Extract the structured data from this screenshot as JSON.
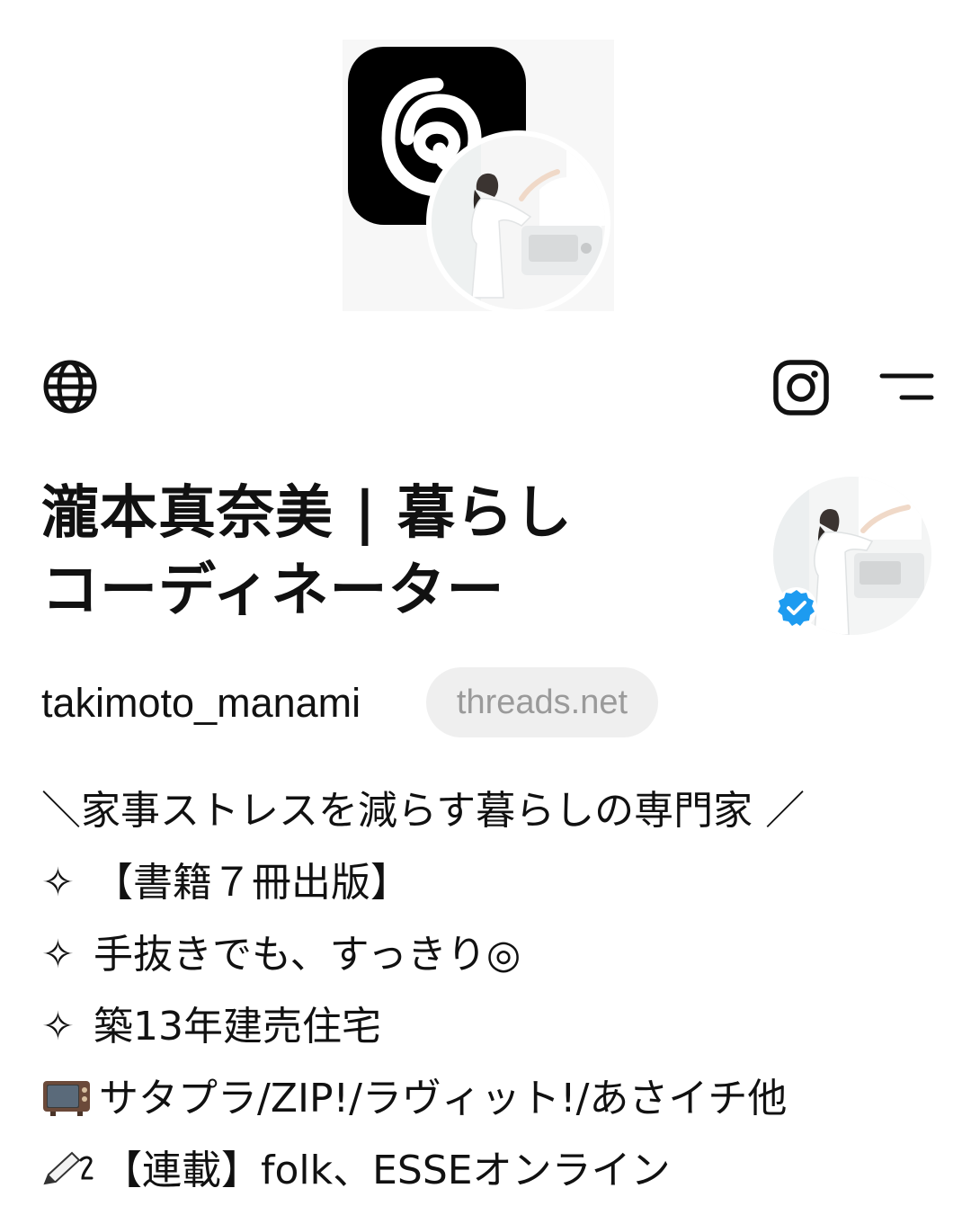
{
  "profile": {
    "display_name": "瀧本真奈美 | 暮らし\nコーディネーター",
    "username": "takimoto_manami",
    "domain": "threads.net"
  },
  "bio": {
    "line1": "＼家事ストレスを減らす暮らしの専門家 ／",
    "line2_icon": "✧",
    "line2_text": " 【書籍７冊出版】",
    "line3_icon": "✧",
    "line3_text": " 手抜きでも、すっきり◎",
    "line4_icon": "✧",
    "line4_text": " 築13年建売住宅",
    "line5_text": "サタプラ/ZIP!/ラヴィット!/あさイチ他",
    "line6_text": "【連載】folk、ESSEオンライン"
  },
  "icons": {
    "header_left": "globe-icon",
    "header_right_1": "instagram-icon",
    "header_right_2": "menu-icon",
    "badge": "verified-badge-icon",
    "logo": "threads-logo-icon",
    "bio_tv": "television-emoji-icon",
    "bio_pencil": "pencil-emoji-icon"
  },
  "colors": {
    "background": "#ffffff",
    "text": "#111111",
    "pill_bg": "#efefef",
    "pill_text": "#9a9a9a",
    "verified": "#1d9bf0"
  }
}
